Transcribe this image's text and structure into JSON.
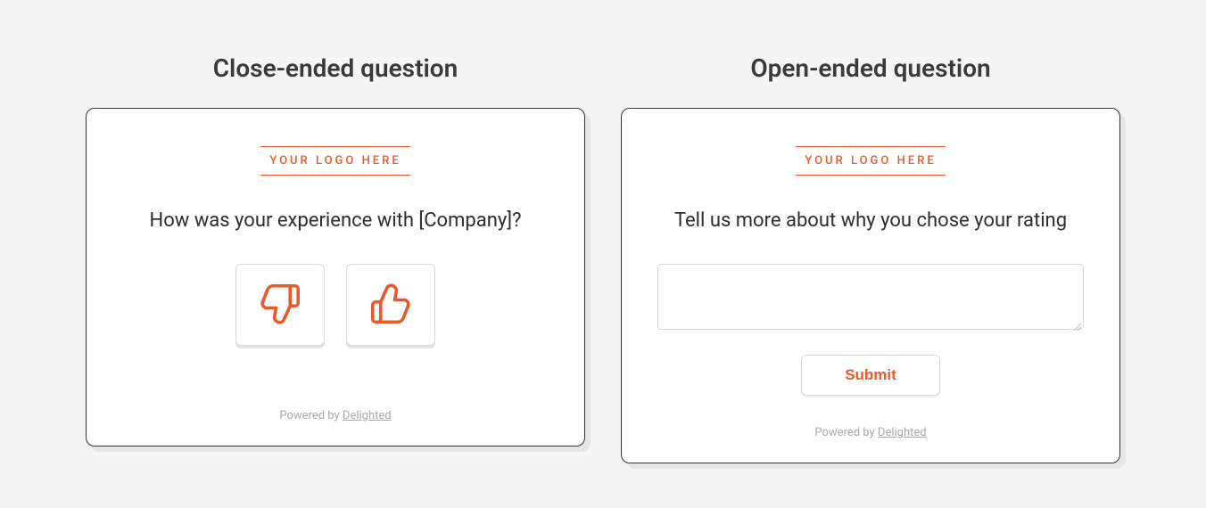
{
  "left": {
    "title": "Close-ended question",
    "logo_text": "YOUR LOGO HERE",
    "question": "How was your experience with [Company]?",
    "footer_prefix": "Powered by ",
    "footer_link": "Delighted"
  },
  "right": {
    "title": "Open-ended question",
    "logo_text": "YOUR LOGO HERE",
    "question": "Tell us more about why you chose your rating",
    "submit_label": "Submit",
    "footer_prefix": "Powered by ",
    "footer_link": "Delighted"
  },
  "colors": {
    "accent": "#e85a2b"
  }
}
